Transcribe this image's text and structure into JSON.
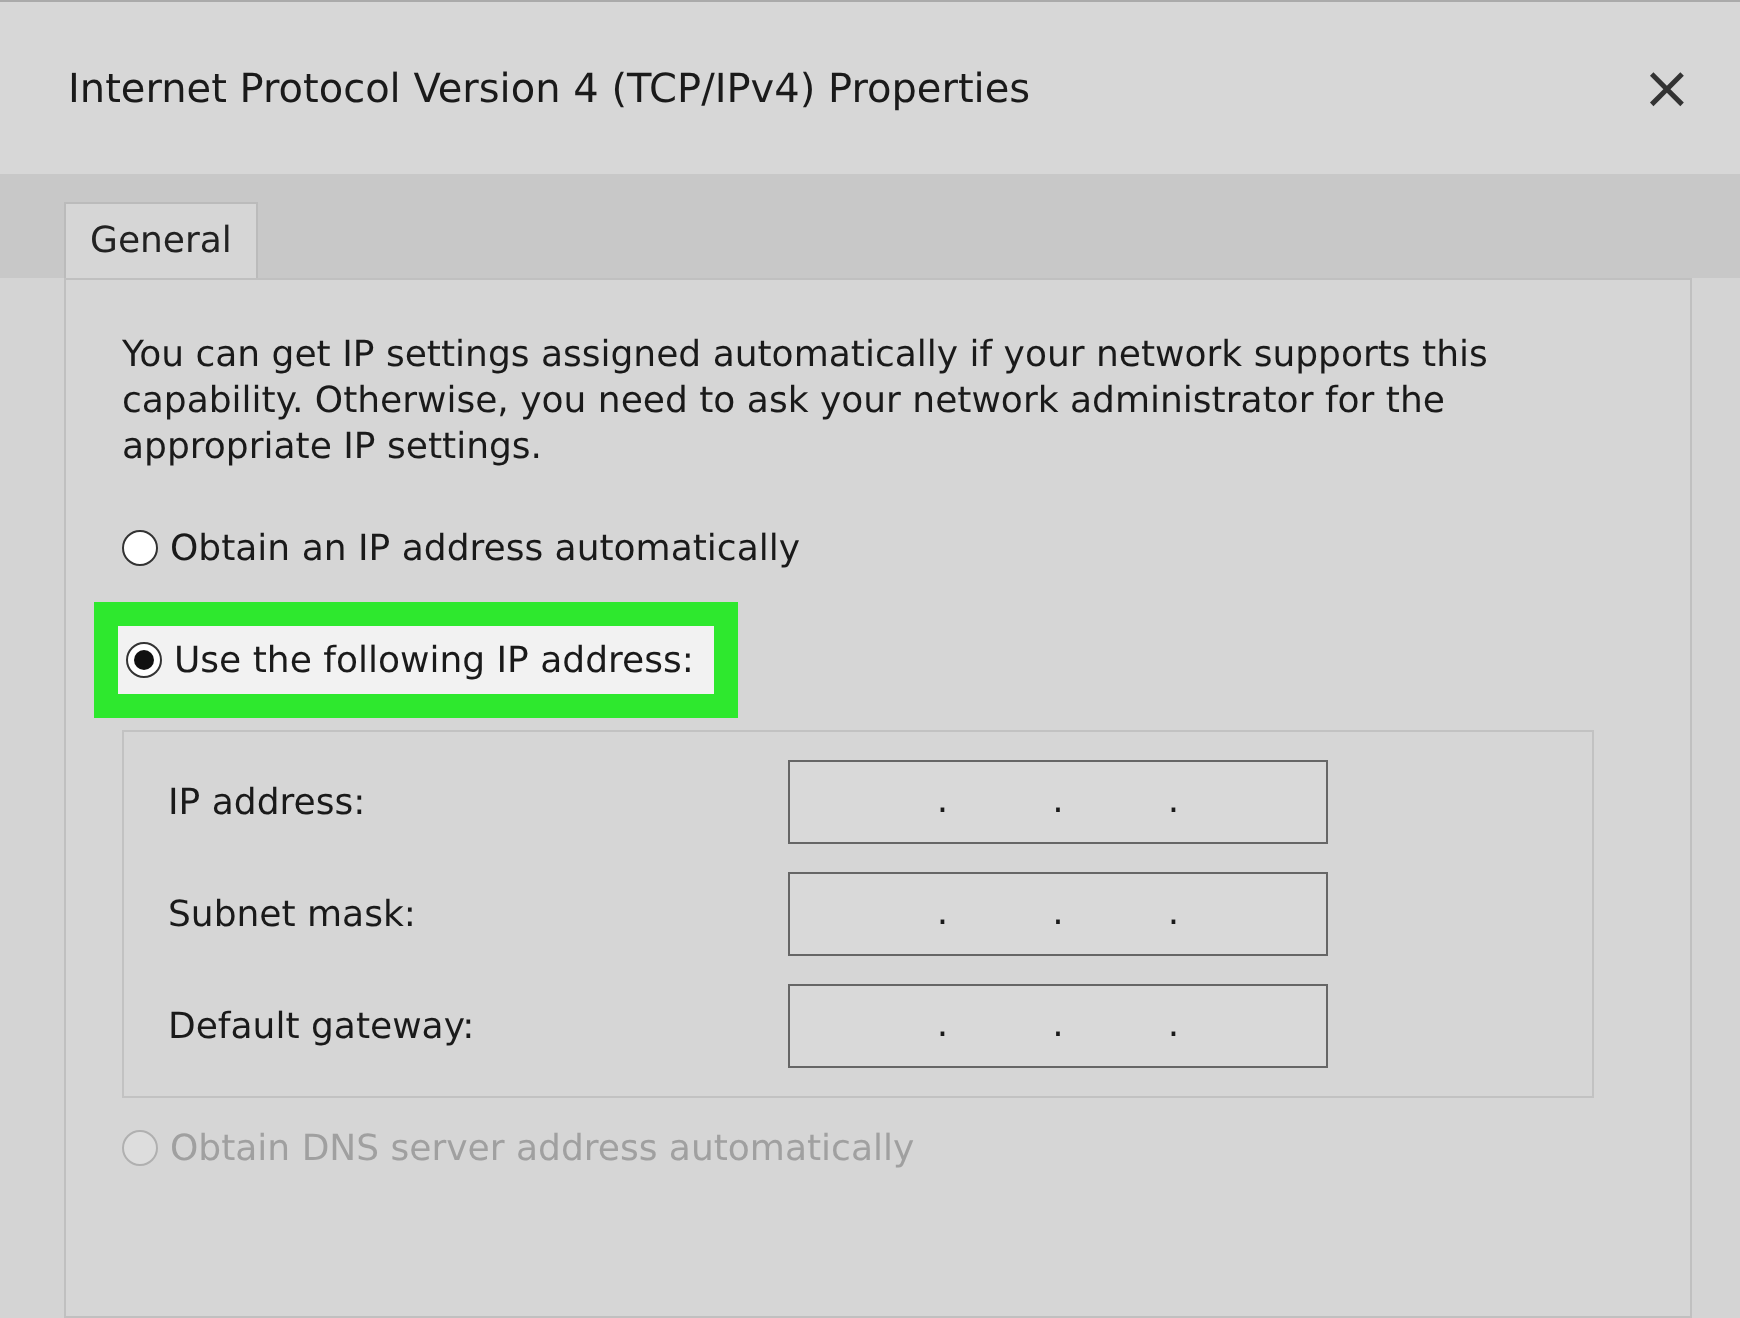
{
  "window": {
    "title": "Internet Protocol Version 4 (TCP/IPv4) Properties",
    "close": "×"
  },
  "tabs": [
    {
      "label": "General",
      "selected": true
    }
  ],
  "intro": "You can get IP settings assigned automatically if your network supports this capability. Otherwise, you need to ask your network administrator for the appropriate IP settings.",
  "ip_options": [
    {
      "label": "Obtain an IP address automatically",
      "selected": false,
      "highlighted": false
    },
    {
      "label": "Use the following IP address:",
      "selected": true,
      "highlighted": true
    }
  ],
  "ip_fields": [
    {
      "label": "IP address:",
      "separators": [
        ".",
        ".",
        "."
      ]
    },
    {
      "label": "Subnet mask:",
      "separators": [
        ".",
        ".",
        "."
      ]
    },
    {
      "label": "Default gateway:",
      "separators": [
        ".",
        ".",
        "."
      ]
    }
  ],
  "dns_options": [
    {
      "label": "Obtain DNS server address automatically",
      "selected": false,
      "disabled": true
    }
  ]
}
